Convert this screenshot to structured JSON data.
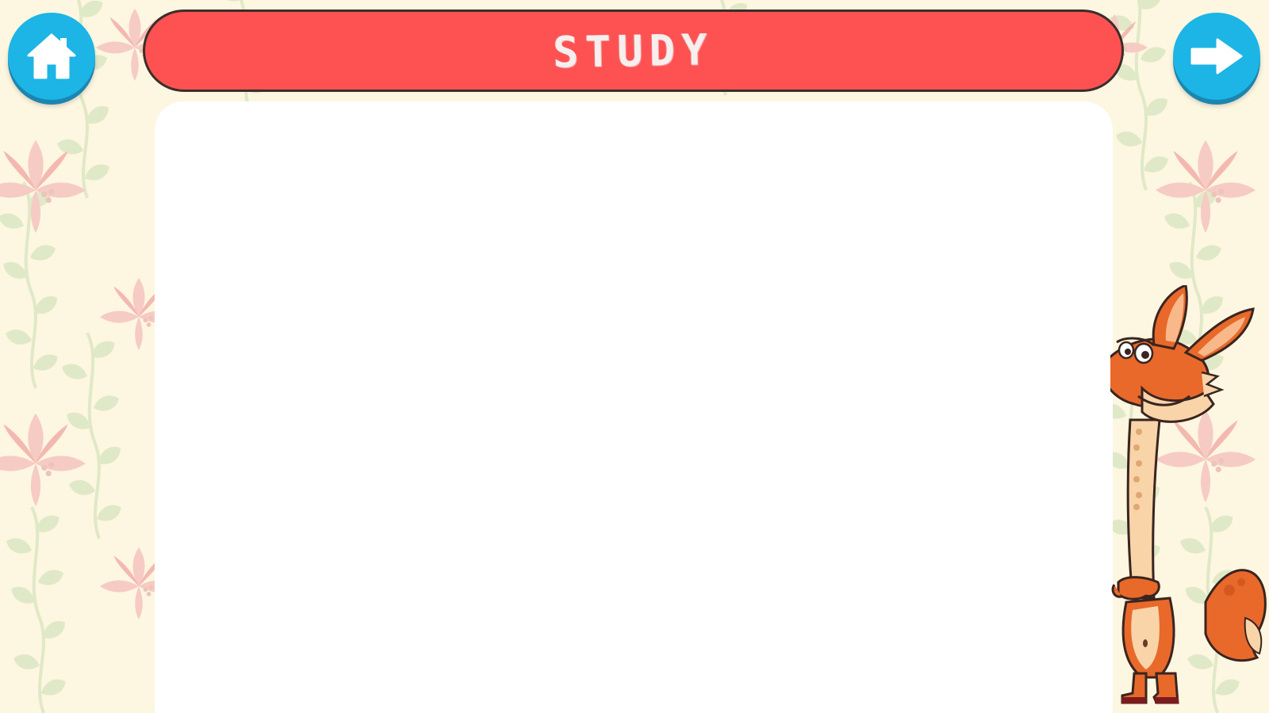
{
  "header": {
    "title": "STUDY"
  },
  "navigation": {
    "home_icon": "home-icon",
    "next_icon": "arrow-right-icon"
  },
  "colors": {
    "background": "#fdf6e0",
    "title_bar": "#fe5252",
    "title_border": "#3b2e2c",
    "button": "#1cb5e5",
    "panel": "#ffffff",
    "mascot_orange": "#e8692a"
  },
  "mascot": {
    "icon": "fox-giraffe-mascot"
  }
}
